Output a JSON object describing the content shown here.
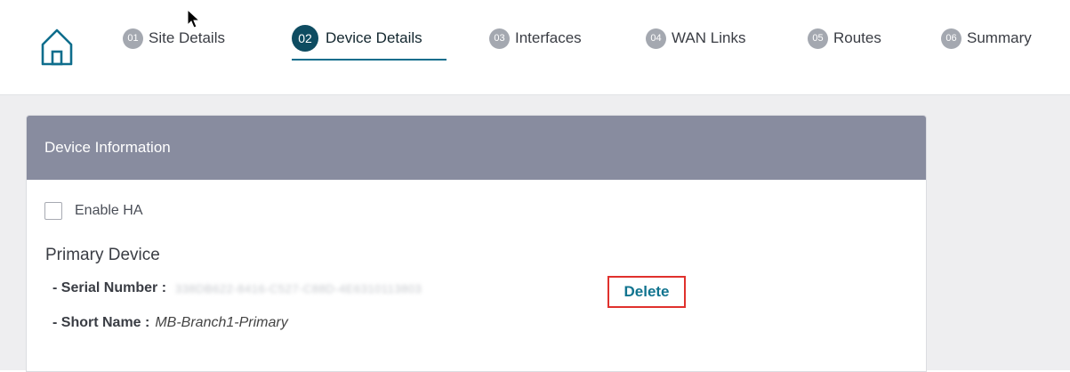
{
  "wizard": {
    "steps": [
      {
        "num": "01",
        "label": "Site Details"
      },
      {
        "num": "02",
        "label": "Device Details"
      },
      {
        "num": "03",
        "label": "Interfaces"
      },
      {
        "num": "04",
        "label": "WAN Links"
      },
      {
        "num": "05",
        "label": "Routes"
      },
      {
        "num": "06",
        "label": "Summary"
      }
    ],
    "active_step": "02"
  },
  "card": {
    "title": "Device Information",
    "enable_ha_label": "Enable HA",
    "enable_ha_checked": false,
    "primary_device": {
      "title": "Primary Device",
      "serial_label": "- Serial Number :",
      "serial_value": "338DB622-8416-C527-C88D-4E6310113803",
      "delete_label": "Delete",
      "short_name_label": "- Short Name :",
      "short_name_value": "MB-Branch1-Primary"
    }
  },
  "icons": {
    "home": "home-icon",
    "cursor": "mouse-pointer-icon"
  },
  "colors": {
    "active_step": "#0e4c61",
    "card_header": "#888c9f",
    "delete_link": "#11748f",
    "highlight_border": "#e0312d"
  }
}
